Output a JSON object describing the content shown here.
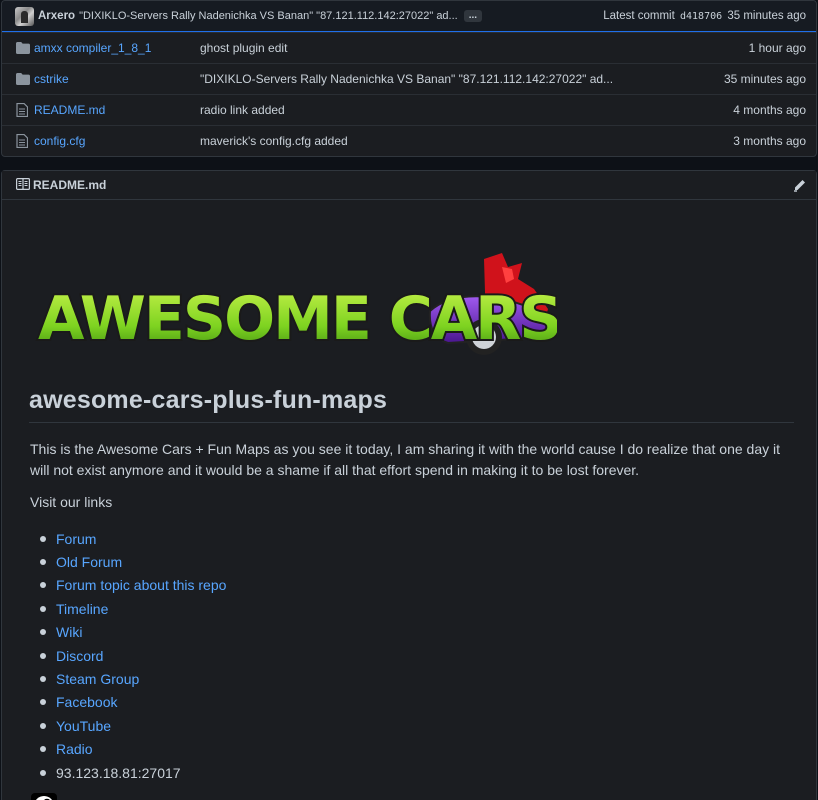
{
  "latest_commit": {
    "author": "Arxero",
    "message": "\"DIXIKLO-Servers Rally Nadenichka VS Banan\" \"87.121.112.142:27022\" ad...",
    "ellipsis": "...",
    "label": "Latest commit",
    "sha": "d418706",
    "age": "35 minutes ago"
  },
  "files": [
    {
      "icon": "folder-icon",
      "name": "amxx compiler_1_8_1",
      "message": "ghost plugin edit",
      "age": "1 hour ago"
    },
    {
      "icon": "folder-icon",
      "name": "cstrike",
      "message": "\"DIXIKLO-Servers Rally Nadenichka VS Banan\" \"87.121.112.142:27022\" ad...",
      "age": "35 minutes ago"
    },
    {
      "icon": "file-icon",
      "name": "README.md",
      "message": "radio link added",
      "age": "4 months ago"
    },
    {
      "icon": "file-icon",
      "name": "config.cfg",
      "message": "maverick's config.cfg added",
      "age": "3 months ago"
    }
  ],
  "readme": {
    "header_title": "README.md",
    "logo_text": "AWESOME CARS",
    "heading": "awesome-cars-plus-fun-maps",
    "intro": "This is the Awesome Cars + Fun Maps as you see it today, I am sharing it with the world cause I do realize that one day it will not exist anymore and it would be a shame if all that effort spend in making it to be lost forever.",
    "visit": "Visit our links",
    "links": [
      "Forum",
      "Old Forum",
      "Forum topic about this repo",
      "Timeline",
      "Wiki",
      "Discord",
      "Steam Group",
      "Facebook",
      "YouTube",
      "Radio"
    ],
    "server_ip": "93.123.18.81:27017"
  },
  "colors": {
    "link": "#58a6ff",
    "text": "#c9d1d9",
    "background": "#1b1d21",
    "logo_green": "#7ed321",
    "car_purple": "#7b2fd6",
    "figure_red": "#d0121b"
  }
}
